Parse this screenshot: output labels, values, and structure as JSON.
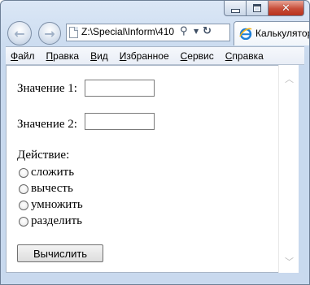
{
  "window": {
    "caption_buttons": [
      "minimize",
      "maximize",
      "close"
    ]
  },
  "nav": {
    "back_icon": "back-arrow-icon",
    "forward_icon": "forward-arrow-icon",
    "address": "Z:\\Special\\Inform\\410"
  },
  "tab": {
    "title": "Калькулятор"
  },
  "menu": {
    "items": [
      {
        "label": "Файл",
        "accel": "Ф",
        "rest": "айл"
      },
      {
        "label": "Правка",
        "accel": "П",
        "rest": "равка"
      },
      {
        "label": "Вид",
        "accel": "В",
        "rest": "ид"
      },
      {
        "label": "Избранное",
        "accel": "И",
        "rest": "збранное"
      },
      {
        "label": "Сервис",
        "accel": "С",
        "rest": "ервис"
      },
      {
        "label": "Справка",
        "accel": "С",
        "rest": "правка"
      }
    ]
  },
  "form": {
    "value1_label": "Значение 1:",
    "value1": "",
    "value2_label": "Значение 2:",
    "value2": "",
    "action_label": "Действие:",
    "operations": [
      "сложить",
      "вычесть",
      "умножить",
      "разделить"
    ],
    "submit_label": "Вычислить"
  }
}
